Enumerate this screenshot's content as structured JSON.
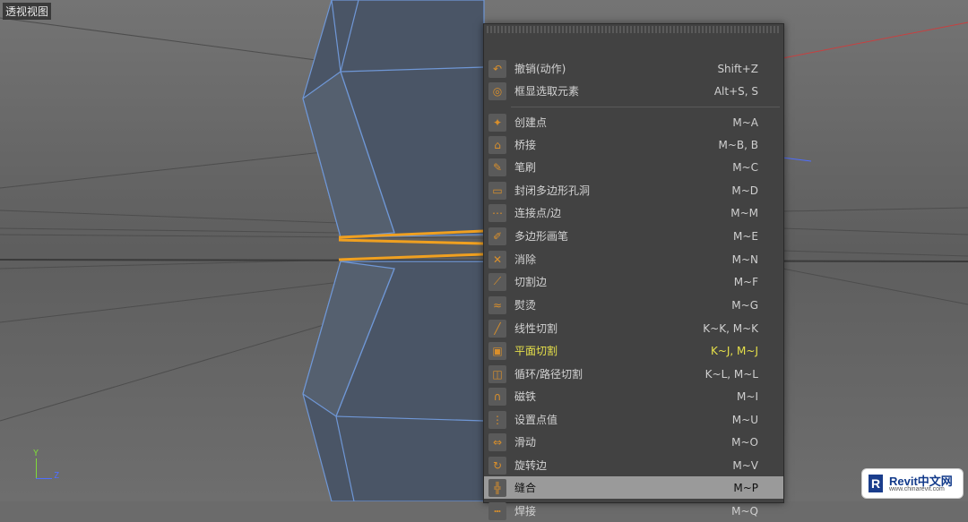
{
  "viewport": {
    "label": "透视视图",
    "axis_y": "Y",
    "axis_z": "Z"
  },
  "menu": {
    "items": [
      {
        "label": "撤销(动作)",
        "shortcut": "Shift+Z",
        "icon": "undo-icon"
      },
      {
        "label": "框显选取元素",
        "shortcut": "Alt+S, S",
        "icon": "frame-selected-icon"
      },
      {
        "label": "创建点",
        "shortcut": "M~A",
        "icon": "create-point-icon"
      },
      {
        "label": "桥接",
        "shortcut": "M~B, B",
        "icon": "bridge-icon"
      },
      {
        "label": "笔刷",
        "shortcut": "M~C",
        "icon": "brush-icon"
      },
      {
        "label": "封闭多边形孔洞",
        "shortcut": "M~D",
        "icon": "close-polygon-hole-icon"
      },
      {
        "label": "连接点/边",
        "shortcut": "M~M",
        "icon": "connect-points-edges-icon"
      },
      {
        "label": "多边形画笔",
        "shortcut": "M~E",
        "icon": "polygon-pen-icon"
      },
      {
        "label": "消除",
        "shortcut": "M~N",
        "icon": "dissolve-icon"
      },
      {
        "label": "切割边",
        "shortcut": "M~F",
        "icon": "edge-cut-icon"
      },
      {
        "label": "熨烫",
        "shortcut": "M~G",
        "icon": "iron-icon"
      },
      {
        "label": "线性切割",
        "shortcut": "K~K, M~K",
        "icon": "line-cut-icon"
      },
      {
        "label": "平面切割",
        "shortcut": "K~J, M~J",
        "icon": "plane-cut-icon"
      },
      {
        "label": "循环/路径切割",
        "shortcut": "K~L, M~L",
        "icon": "loop-path-cut-icon"
      },
      {
        "label": "磁铁",
        "shortcut": "M~I",
        "icon": "magnet-icon"
      },
      {
        "label": "设置点值",
        "shortcut": "M~U",
        "icon": "set-point-value-icon"
      },
      {
        "label": "滑动",
        "shortcut": "M~O",
        "icon": "slide-icon"
      },
      {
        "label": "旋转边",
        "shortcut": "M~V",
        "icon": "spin-edge-icon"
      },
      {
        "label": "缝合",
        "shortcut": "M~P",
        "icon": "stitch-and-sew-icon"
      },
      {
        "label": "焊接",
        "shortcut": "M~Q",
        "icon": "weld-icon"
      }
    ],
    "highlighted_index": 18,
    "yellow_index": 12
  },
  "watermark": {
    "title": "Revit中文网",
    "url": "www.chinarevit.com"
  },
  "colors": {
    "menu_bg": "#424242",
    "highlight": "#9a9a9a",
    "accent_orange": "#f0a020",
    "mesh_blue": "#5c7fb5",
    "yellow_text": "#e6e04a"
  }
}
